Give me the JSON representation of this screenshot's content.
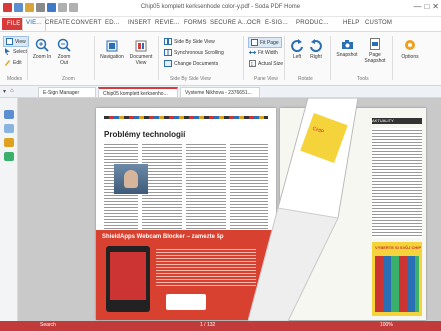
{
  "window": {
    "title": "Chip05 komplett kerksenhode color-y.pdf   -   Soda PDF Home",
    "controls": [
      "—",
      "□",
      "✕"
    ]
  },
  "menu": {
    "tabs": [
      "FILE",
      "VIE...",
      "CREATE",
      "CONVERT",
      "ED...",
      "INSERT",
      "REVIE...",
      "FORMS",
      "SECURE A...",
      "OCR",
      "E-SIG...",
      "PRODUC...",
      "HELP",
      "CUSTOM"
    ]
  },
  "ribbon": {
    "view_label": "View",
    "select_label": "Select",
    "edit_label": "Edit",
    "zoom_in_label": "Zoom In",
    "zoom_out_label": "Zoom Out",
    "navigation_label": "Navigation",
    "document_view_label": "Document View",
    "side_by_side_label": "Side By Side View",
    "sync_scrolling_label": "Synchronous Scrolling",
    "change_documents_label": "Change Documents",
    "fit_page_label": "Fit Page",
    "fit_width_label": "Fit Width",
    "actual_size_label": "Actual Size",
    "left_label": "Left",
    "right_label": "Right",
    "snapshot_label": "Snapshot",
    "page_snapshot_label": "Page Snapshot",
    "options_label": "Options",
    "groups": {
      "modes": "Modes",
      "zoom": "Zoom",
      "side_by_side": "Side By Side View",
      "pane_view": "Pane View",
      "rotate": "Rotate",
      "tools": "Tools"
    }
  },
  "doc_tabs": {
    "tab1": "E-Sign Manager",
    "tab2": "Chip05 komplett kerksenho...",
    "tab3": "Vysteme Nikhova - 2376651..."
  },
  "document": {
    "left_page": {
      "heading": "Problémy technologií",
      "banner": "ShieldApps Webcam Blocker – zamezte šp"
    },
    "right_page": {
      "label_a": "AKTUALITY",
      "label_b": "CHIP",
      "promo": "VYBERTE SI SVŮJ CHIP"
    }
  },
  "status": {
    "left": "Search",
    "page": "1 / 132",
    "zoom": "100%"
  },
  "colors": {
    "accent_red": "#d83a3a",
    "ribbon_blue": "#1b6fb3",
    "banner_red": "#d8412f",
    "yellow": "#f5d33a"
  }
}
